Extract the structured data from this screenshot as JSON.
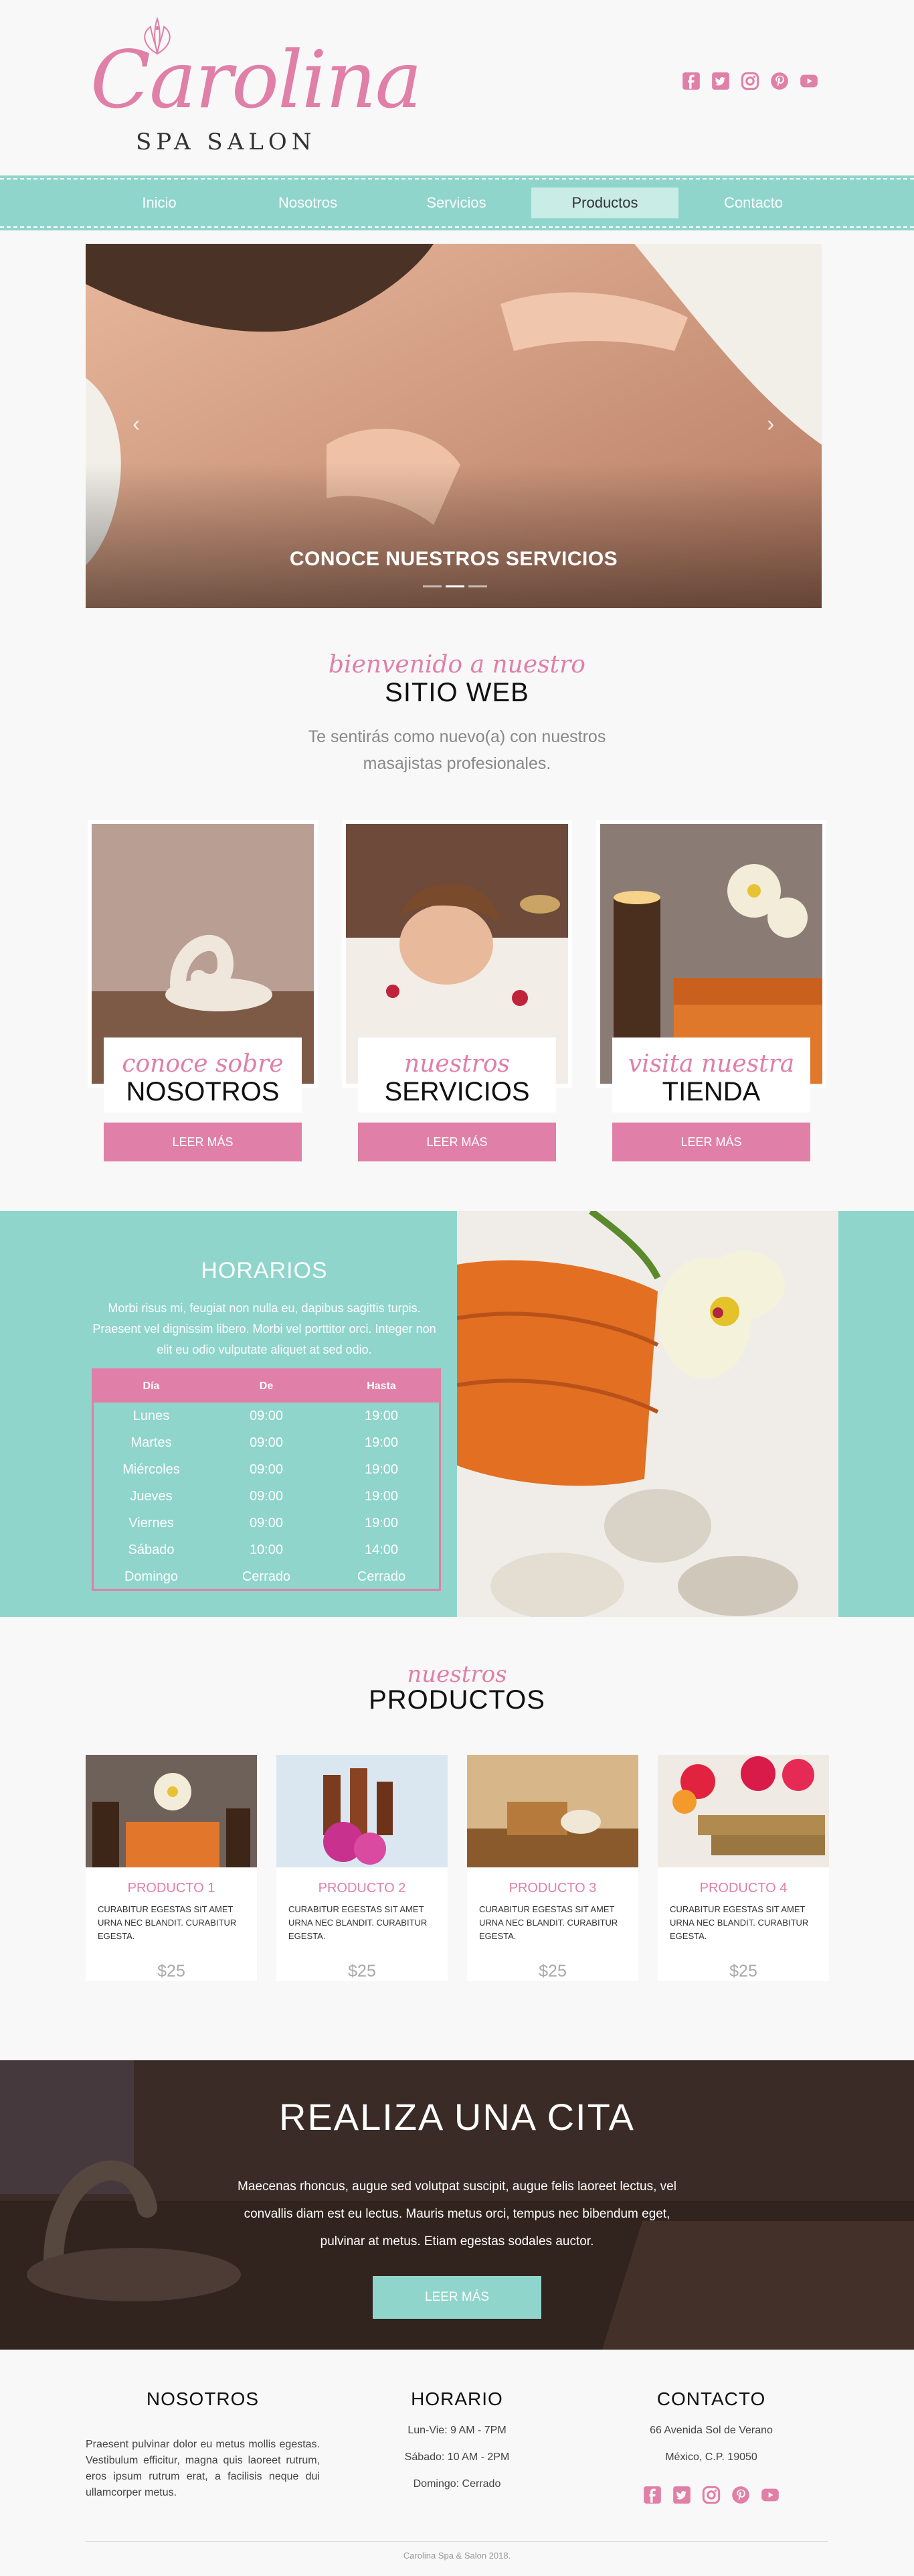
{
  "brand": {
    "name": "Carolina",
    "tagline": "SPA SALON"
  },
  "social": [
    "facebook-icon",
    "twitter-icon",
    "instagram-icon",
    "pinterest-icon",
    "youtube-icon"
  ],
  "colors": {
    "pink": "#e07fa7",
    "teal": "#8fd5cc"
  },
  "nav": {
    "items": [
      "Inicio",
      "Nosotros",
      "Servicios",
      "Productos",
      "Contacto"
    ],
    "active": "Productos"
  },
  "slider": {
    "caption": "CONOCE NUESTROS SERVICIOS",
    "prev": "‹",
    "next": "›"
  },
  "welcome": {
    "script": "bienvenido a nuestro",
    "title": "SITIO WEB",
    "text": "Te sentirás como nuevo(a) con nuestros masajistas profesionales."
  },
  "cards": [
    {
      "script": "conoce sobre",
      "title": "NOSOTROS",
      "button": "LEER MÁS"
    },
    {
      "script": "nuestros",
      "title": "SERVICIOS",
      "button": "LEER MÁS"
    },
    {
      "script": "visita nuestra",
      "title": "TIENDA",
      "button": "LEER MÁS"
    }
  ],
  "hours": {
    "title": "HORARIOS",
    "text": "Morbi risus mi, feugiat non nulla eu, dapibus sagittis turpis. Praesent vel dignissim libero. Morbi vel porttitor orci. Integer non elit eu odio vulputate aliquet at sed odio.",
    "headers": [
      "Día",
      "De",
      "Hasta"
    ],
    "rows": [
      [
        "Lunes",
        "09:00",
        "19:00"
      ],
      [
        "Martes",
        "09:00",
        "19:00"
      ],
      [
        "Miércoles",
        "09:00",
        "19:00"
      ],
      [
        "Jueves",
        "09:00",
        "19:00"
      ],
      [
        "Viernes",
        "09:00",
        "19:00"
      ],
      [
        "Sábado",
        "10:00",
        "14:00"
      ],
      [
        "Domingo",
        "Cerrado",
        "Cerrado"
      ]
    ]
  },
  "products": {
    "script": "nuestros",
    "title": "PRODUCTOS",
    "items": [
      {
        "name": "PRODUCTO 1",
        "desc": "CURABITUR EGESTAS SIT AMET URNA NEC BLANDIT. CURABITUR EGESTA.",
        "price": "$25"
      },
      {
        "name": "PRODUCTO 2",
        "desc": "CURABITUR EGESTAS SIT AMET URNA NEC BLANDIT. CURABITUR EGESTA.",
        "price": "$25"
      },
      {
        "name": "PRODUCTO 3",
        "desc": "CURABITUR EGESTAS SIT AMET URNA NEC BLANDIT. CURABITUR EGESTA.",
        "price": "$25"
      },
      {
        "name": "PRODUCTO 4",
        "desc": "CURABITUR EGESTAS SIT AMET URNA NEC BLANDIT. CURABITUR EGESTA.",
        "price": "$25"
      }
    ]
  },
  "appointment": {
    "title": "REALIZA UNA CITA",
    "text": "Maecenas rhoncus, augue sed volutpat suscipit, augue felis laoreet lectus, vel convallis diam est eu lectus. Mauris metus orci, tempus nec bibendum eget, pulvinar at metus. Etiam egestas sodales auctor.",
    "button": "LEER MÁS"
  },
  "footer": {
    "about": {
      "title": "NOSOTROS",
      "text": "Praesent pulvinar dolor eu metus mollis egestas. Vestibulum efficitur, magna quis laoreet rutrum, eros ipsum rutrum erat, a facilisis neque dui ullamcorper metus."
    },
    "schedule": {
      "title": "HORARIO",
      "lines": [
        "Lun-Vie: 9 AM - 7PM",
        "Sábado: 10 AM - 2PM",
        "Domingo: Cerrado"
      ]
    },
    "contact": {
      "title": "CONTACTO",
      "lines": [
        "66 Avenida Sol de Verano",
        "México, C.P. 19050"
      ]
    },
    "copyright": "Carolina Spa & Salon 2018."
  }
}
